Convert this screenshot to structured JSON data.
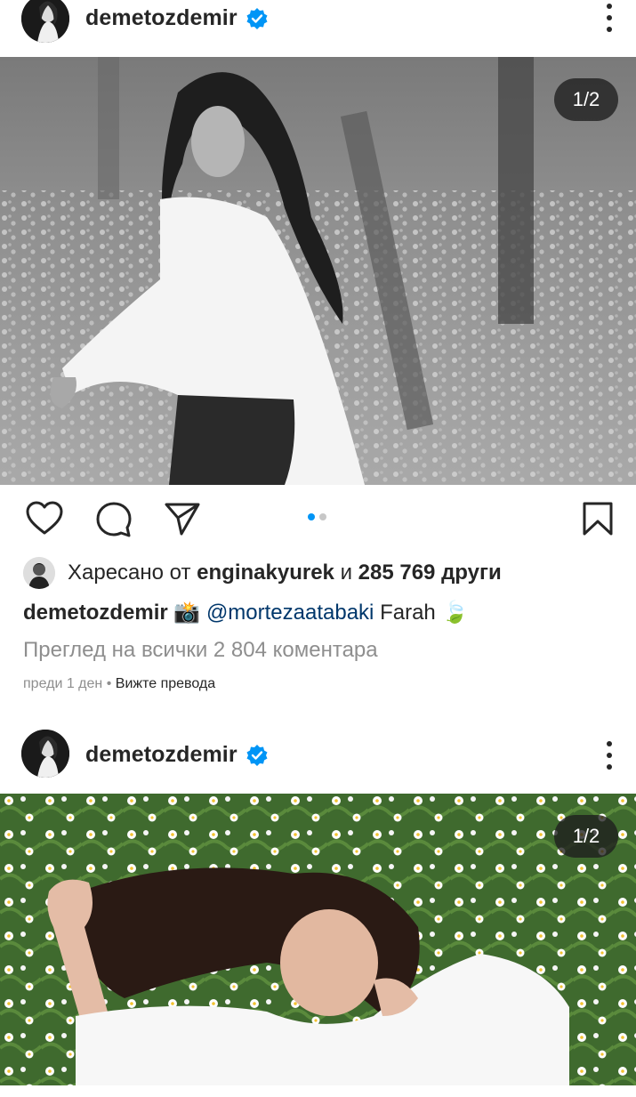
{
  "posts": [
    {
      "username": "demetozdemir",
      "image_counter": "1/2",
      "liked_by_label": "Харесано от",
      "liked_by_user": "enginakyurek",
      "liked_conjunction": "и",
      "likes_count": "285 769 други",
      "caption_user": "demetozdemir",
      "caption_emoji": "📸",
      "caption_mention": "@mortezaatabaki",
      "caption_text": "Farah",
      "caption_emoji_end": "🍃",
      "comments_link": "Преглед на всички 2 804 коментара",
      "time_ago": "преди 1 ден",
      "separator": "•",
      "see_translation": "Вижте превода"
    },
    {
      "username": "demetozdemir",
      "image_counter": "1/2"
    }
  ],
  "icons": {
    "verified": "verified-badge-icon",
    "more": "more-options-icon",
    "like": "heart-icon",
    "comment": "comment-bubble-icon",
    "share": "paper-plane-icon",
    "save": "bookmark-icon"
  },
  "colors": {
    "accent": "#0095f6",
    "mention": "#00376b",
    "muted": "#8e8e8e",
    "text": "#262626"
  }
}
